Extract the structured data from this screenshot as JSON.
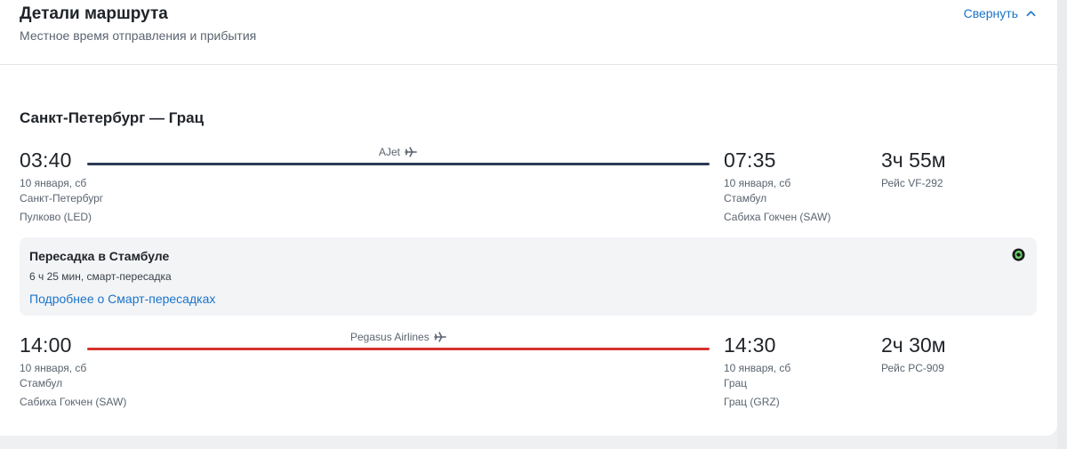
{
  "header": {
    "title": "Детали маршрута",
    "subtitle": "Местное время отправления и прибытия",
    "collapse_label": "Свернуть"
  },
  "route": {
    "title": "Санкт-Петербург — Грац"
  },
  "segments": [
    {
      "depart_time": "03:40",
      "depart_date": "10 января, сб",
      "depart_city": "Санкт-Петербург",
      "depart_airport": "Пулково (LED)",
      "airline": "AJet",
      "line_color": "#2b3a55",
      "arrive_time": "07:35",
      "arrive_date": "10 января, сб",
      "arrive_city": "Стамбул",
      "arrive_airport": "Сабиха Гокчен (SAW)",
      "duration": "3ч 55м",
      "flight_number": "Рейс VF-292"
    },
    {
      "depart_time": "14:00",
      "depart_date": "10 января, сб",
      "depart_city": "Стамбул",
      "depart_airport": "Сабиха Гокчен (SAW)",
      "airline": "Pegasus Airlines",
      "line_color": "#d7322c",
      "arrive_time": "14:30",
      "arrive_date": "10 января, сб",
      "arrive_city": "Грац",
      "arrive_airport": "Грац (GRZ)",
      "duration": "2ч 30м",
      "flight_number": "Рейс PC-909"
    }
  ],
  "transfer": {
    "title": "Пересадка в Стамбуле",
    "details": "6 ч 25 мин, смарт-пересадка",
    "link_label": "Подробнее о Смарт-пересадках",
    "badge_icon": "smart-transfer-icon"
  },
  "colors": {
    "link": "#1a73c8",
    "text": "#1f2328",
    "muted": "#5a6470"
  }
}
